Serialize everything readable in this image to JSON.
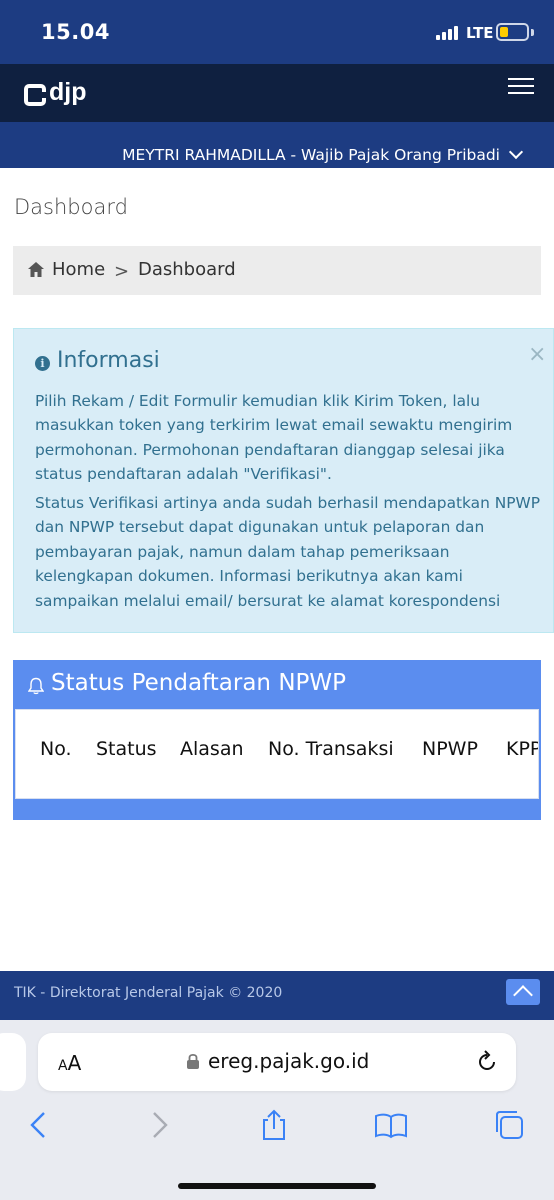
{
  "status_bar": {
    "time": "15.04",
    "network": "LTE",
    "battery_color": "#ffcc00"
  },
  "app_header": {
    "logo": "djp",
    "menu_icon": "hamburger-menu-icon"
  },
  "user_bar": {
    "user_label": "MEYTRI RAHMADILLA - Wajib Pajak Orang Pribadi"
  },
  "page": {
    "title": "Dashboard",
    "breadcrumb": {
      "home": "Home",
      "separator": ">",
      "current": "Dashboard"
    }
  },
  "info": {
    "title": "Informasi",
    "close": "×",
    "paragraph1": "Pilih Rekam / Edit Formulir kemudian klik Kirim Token, lalu masukkan token yang terkirim lewat email sewaktu mengirim permohonan. Permohonan pendaftaran dianggap selesai jika status pendaftaran adalah \"Verifikasi\".",
    "paragraph2": "Status Verifikasi artinya anda sudah berhasil mendapatkan NPWP dan NPWP tersebut dapat digunakan untuk pelaporan dan pembayaran pajak, namun dalam tahap pemeriksaan kelengkapan dokumen. Informasi berikutnya akan kami sampaikan melalui email/ bersurat ke alamat korespondensi"
  },
  "status_panel": {
    "title": "Status Pendaftaran NPWP",
    "columns": [
      "No.",
      "Status",
      "Alasan",
      "No. Transaksi",
      "NPWP",
      "KPP"
    ]
  },
  "footer": {
    "text": "TIK - Direktorat Jenderal Pajak © 2020"
  },
  "browser": {
    "text_size_label": "AA",
    "url": "ereg.pajak.go.id"
  },
  "colors": {
    "primary": "#1d3c82",
    "header_dark": "#0f2040",
    "accent": "#5b8def",
    "info_bg": "#d9edf7",
    "info_text": "#31708f"
  }
}
